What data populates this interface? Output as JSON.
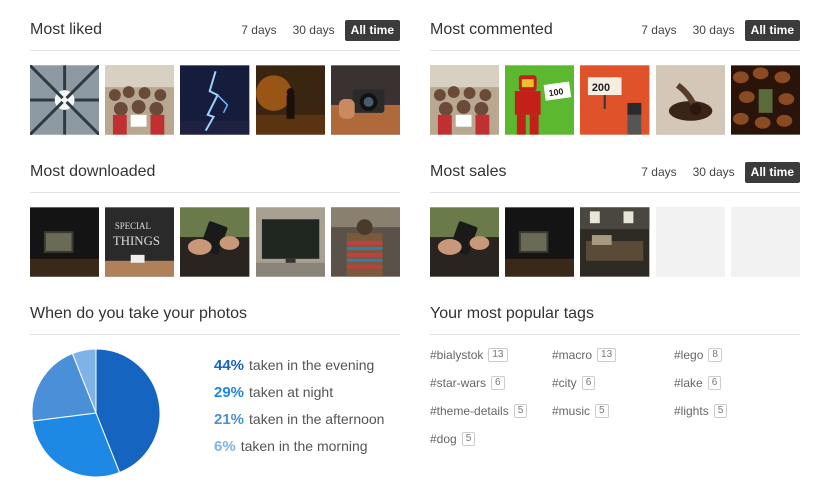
{
  "filters": {
    "d7": "7 days",
    "d30": "30 days",
    "all": "All time"
  },
  "most_liked": {
    "title": "Most liked",
    "thumbs": [
      "forest-canopy",
      "group-photo",
      "lightning",
      "foggy-night-figure",
      "camera-hands"
    ]
  },
  "most_commented": {
    "title": "Most commented",
    "thumbs": [
      "group-photo",
      "lego-ironman",
      "lego-sign-200",
      "chocolate-spoon",
      "coffee-beans-lego"
    ]
  },
  "most_downloaded": {
    "title": "Most downloaded",
    "thumbs": [
      "dark-laptop",
      "chalk-lettering",
      "phone-hands",
      "blank-tv",
      "cat-pattern"
    ]
  },
  "most_sales": {
    "title": "Most sales",
    "thumbs": [
      "phone-hands",
      "dark-laptop",
      "cafe-interior",
      "",
      ""
    ]
  },
  "when": {
    "title": "When do you take your photos",
    "items": [
      {
        "pct": "44%",
        "label": "taken in the evening",
        "value": 44,
        "color": "#1565c0"
      },
      {
        "pct": "29%",
        "label": "taken at night",
        "value": 29,
        "color": "#1e88e5"
      },
      {
        "pct": "21%",
        "label": "taken in the afternoon",
        "value": 21,
        "color": "#4a90d9"
      },
      {
        "pct": "6%",
        "label": "taken in the morning",
        "value": 6,
        "color": "#7fb3e8"
      }
    ]
  },
  "tags": {
    "title": "Your most popular tags",
    "items": [
      {
        "name": "#bialystok",
        "count": "13"
      },
      {
        "name": "#macro",
        "count": "13"
      },
      {
        "name": "#lego",
        "count": "8"
      },
      {
        "name": "#star-wars",
        "count": "6"
      },
      {
        "name": "#city",
        "count": "6"
      },
      {
        "name": "#lake",
        "count": "6"
      },
      {
        "name": "#theme-details",
        "count": "5"
      },
      {
        "name": "#music",
        "count": "5"
      },
      {
        "name": "#lights",
        "count": "5"
      },
      {
        "name": "#dog",
        "count": "5"
      }
    ]
  }
}
